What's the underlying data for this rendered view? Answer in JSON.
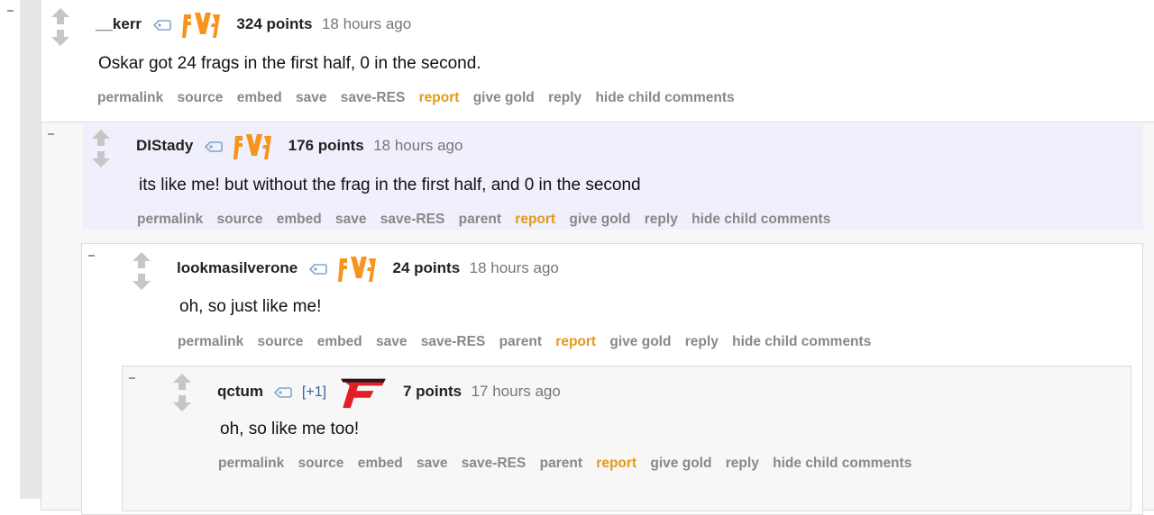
{
  "comments": [
    {
      "username": "__kerr",
      "flair": "fnatic-icon",
      "res_votes": "",
      "points": "324 points",
      "time": "18 hours ago",
      "body": "Oskar got 24 frags in the first half, 0 in the second.",
      "actions": [
        "permalink",
        "source",
        "embed",
        "save",
        "save-RES",
        "report",
        "give gold",
        "reply",
        "hide child comments"
      ]
    },
    {
      "username": "DIStady",
      "flair": "fnatic-icon",
      "res_votes": "",
      "points": "176 points",
      "time": "18 hours ago",
      "body": "its like me! but without the frag in the first half, and 0 in the second",
      "actions": [
        "permalink",
        "source",
        "embed",
        "save",
        "save-RES",
        "parent",
        "report",
        "give gold",
        "reply",
        "hide child comments"
      ]
    },
    {
      "username": "lookmasilverone",
      "flair": "fnatic-icon",
      "res_votes": "",
      "points": "24 points",
      "time": "18 hours ago",
      "body": "oh, so just like me!",
      "actions": [
        "permalink",
        "source",
        "embed",
        "save",
        "save-RES",
        "parent",
        "report",
        "give gold",
        "reply",
        "hide child comments"
      ]
    },
    {
      "username": "qctum",
      "flair": "faze-clan-icon",
      "res_votes": "[+1]",
      "points": "7 points",
      "time": "17 hours ago",
      "body": "oh, so like me too!",
      "actions": [
        "permalink",
        "source",
        "embed",
        "save",
        "save-RES",
        "parent",
        "report",
        "give gold",
        "reply",
        "hide child comments"
      ]
    }
  ],
  "colors": {
    "report_link": "#e39a1a",
    "action_link": "#888888",
    "highlight_bg": "#eff0fb",
    "nested_bg": "#f7f7f8",
    "res_votes": "#336699"
  }
}
